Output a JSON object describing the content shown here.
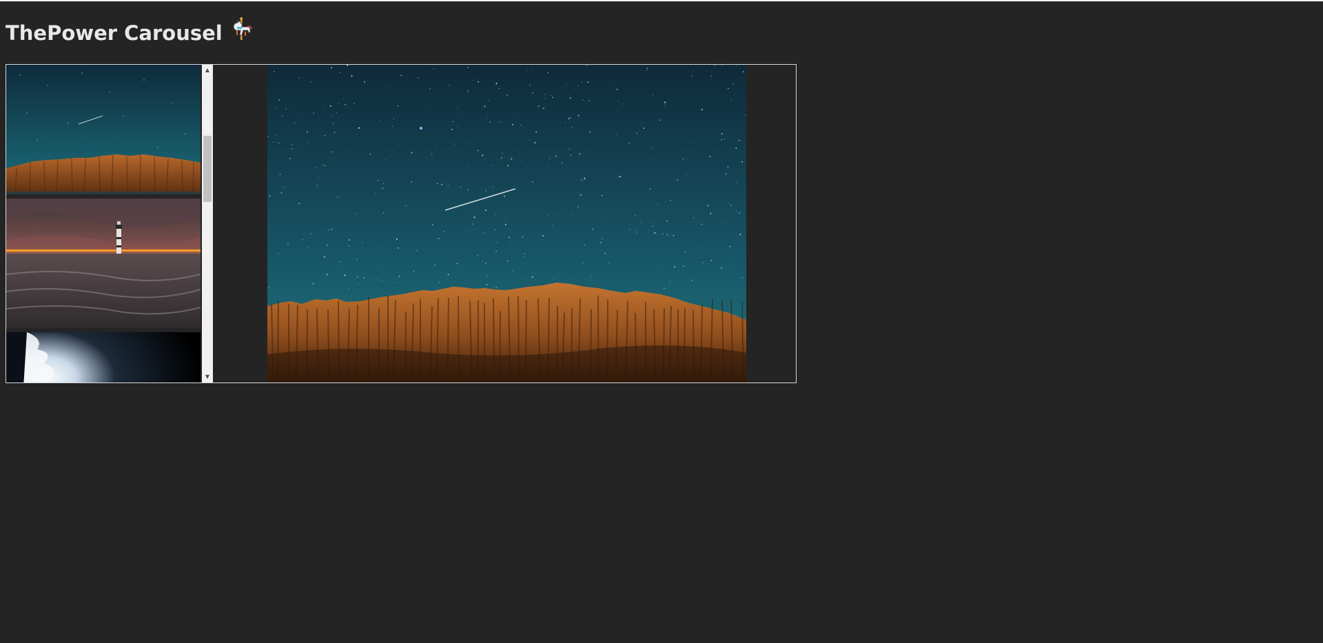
{
  "page": {
    "title": "ThePower Carousel",
    "title_icon": "carousel-horse-icon"
  },
  "thumbnails": [
    {
      "subject": "night-sky-cliffs",
      "selected": true
    },
    {
      "subject": "lighthouse-sunset",
      "selected": false
    },
    {
      "subject": "bright-cloud-dark",
      "selected": false
    }
  ],
  "main_image": {
    "subject": "night-sky-cliffs"
  },
  "colors": {
    "background": "#242424",
    "border": "#d9d9d9",
    "title_text": "#e8e8e8",
    "sky_top": "#0f2a3a",
    "sky_bottom": "#1a6d7a",
    "cliff": "#a35a25"
  }
}
